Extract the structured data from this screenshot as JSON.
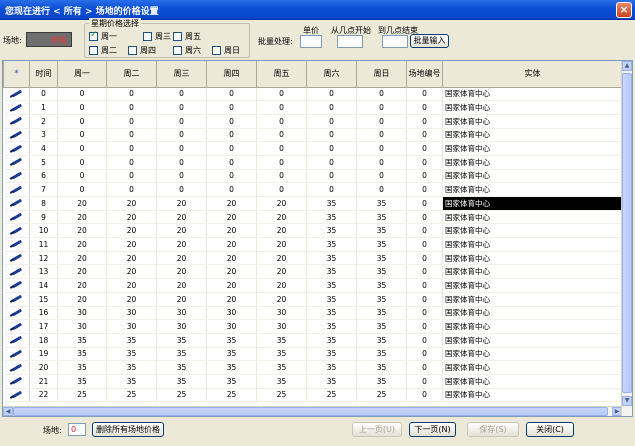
{
  "window": {
    "title": "您现在进行 < 所有 > 场地的价格设置",
    "close_label": "×"
  },
  "filter": {
    "venue_label": "场地:",
    "venue_value": "所有",
    "week_group_title": "星期价格选择",
    "days": [
      {
        "label": "周一",
        "checked": true
      },
      {
        "label": "周三",
        "checked": false
      },
      {
        "label": "周五",
        "checked": false
      },
      {
        "label": "周二",
        "checked": false
      },
      {
        "label": "周四",
        "checked": false
      },
      {
        "label": "周六",
        "checked": false
      },
      {
        "label": "周日",
        "checked": false
      }
    ],
    "batch_label": "批量处理:",
    "unit_price_label": "单价",
    "from_label": "从几点开始",
    "to_label": "到几点结束",
    "batch_button": "批量输入"
  },
  "grid": {
    "header_star": "*",
    "columns": [
      "时间",
      "周一",
      "周二",
      "周三",
      "周四",
      "周五",
      "周六",
      "周日",
      "场地编号",
      "实体"
    ],
    "rows": [
      [
        "0",
        "0",
        "0",
        "0",
        "0",
        "0",
        "0",
        "0",
        "0",
        "国家体育中心"
      ],
      [
        "1",
        "0",
        "0",
        "0",
        "0",
        "0",
        "0",
        "0",
        "0",
        "国家体育中心"
      ],
      [
        "2",
        "0",
        "0",
        "0",
        "0",
        "0",
        "0",
        "0",
        "0",
        "国家体育中心"
      ],
      [
        "3",
        "0",
        "0",
        "0",
        "0",
        "0",
        "0",
        "0",
        "0",
        "国家体育中心"
      ],
      [
        "4",
        "0",
        "0",
        "0",
        "0",
        "0",
        "0",
        "0",
        "0",
        "国家体育中心"
      ],
      [
        "5",
        "0",
        "0",
        "0",
        "0",
        "0",
        "0",
        "0",
        "0",
        "国家体育中心"
      ],
      [
        "6",
        "0",
        "0",
        "0",
        "0",
        "0",
        "0",
        "0",
        "0",
        "国家体育中心"
      ],
      [
        "7",
        "0",
        "0",
        "0",
        "0",
        "0",
        "0",
        "0",
        "0",
        "国家体育中心"
      ],
      [
        "8",
        "20",
        "20",
        "20",
        "20",
        "20",
        "35",
        "35",
        "0",
        "国家体育中心"
      ],
      [
        "9",
        "20",
        "20",
        "20",
        "20",
        "20",
        "35",
        "35",
        "0",
        "国家体育中心"
      ],
      [
        "10",
        "20",
        "20",
        "20",
        "20",
        "20",
        "35",
        "35",
        "0",
        "国家体育中心"
      ],
      [
        "11",
        "20",
        "20",
        "20",
        "20",
        "20",
        "35",
        "35",
        "0",
        "国家体育中心"
      ],
      [
        "12",
        "20",
        "20",
        "20",
        "20",
        "20",
        "35",
        "35",
        "0",
        "国家体育中心"
      ],
      [
        "13",
        "20",
        "20",
        "20",
        "20",
        "20",
        "35",
        "35",
        "0",
        "国家体育中心"
      ],
      [
        "14",
        "20",
        "20",
        "20",
        "20",
        "20",
        "35",
        "35",
        "0",
        "国家体育中心"
      ],
      [
        "15",
        "20",
        "20",
        "20",
        "20",
        "20",
        "35",
        "35",
        "0",
        "国家体育中心"
      ],
      [
        "16",
        "30",
        "30",
        "30",
        "30",
        "30",
        "35",
        "35",
        "0",
        "国家体育中心"
      ],
      [
        "17",
        "30",
        "30",
        "30",
        "30",
        "30",
        "35",
        "35",
        "0",
        "国家体育中心"
      ],
      [
        "18",
        "35",
        "35",
        "35",
        "35",
        "35",
        "35",
        "35",
        "0",
        "国家体育中心"
      ],
      [
        "19",
        "35",
        "35",
        "35",
        "35",
        "35",
        "35",
        "35",
        "0",
        "国家体育中心"
      ],
      [
        "20",
        "35",
        "35",
        "35",
        "35",
        "35",
        "35",
        "35",
        "0",
        "国家体育中心"
      ],
      [
        "21",
        "35",
        "35",
        "35",
        "35",
        "35",
        "35",
        "35",
        "0",
        "国家体育中心"
      ],
      [
        "22",
        "25",
        "25",
        "25",
        "25",
        "25",
        "25",
        "25",
        "0",
        "国家体育中心"
      ]
    ],
    "selected_row": 8
  },
  "footer": {
    "venue_label": "场地:",
    "venue_value": "0",
    "delete_all_button": "删除所有场地价格",
    "prev_button": "上一页(U)",
    "next_button": "下一页(N)",
    "save_button": "保存(S)",
    "close_button": "关闭(C)"
  }
}
